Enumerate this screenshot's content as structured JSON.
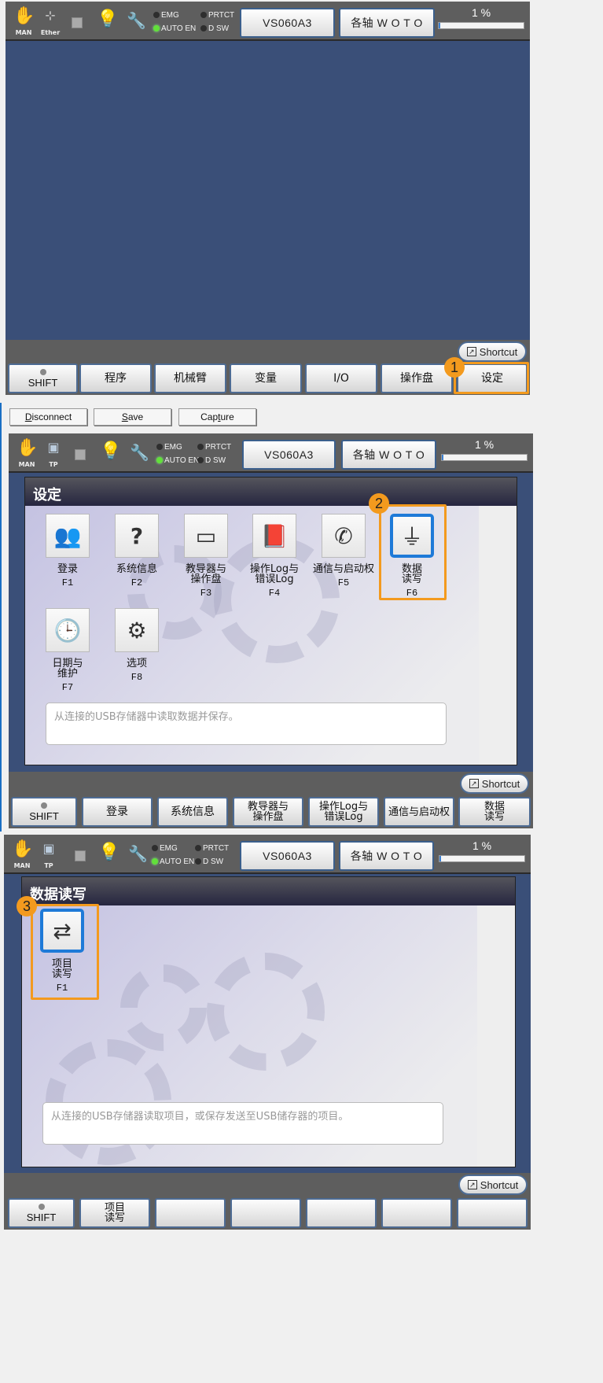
{
  "statusbar": {
    "mode_label": "MAN",
    "conn_label_1": "Ether",
    "conn_label_2": "TP",
    "indicators": {
      "emg": "EMG",
      "prtct": "PRTCT",
      "auto_en": "AUTO EN",
      "dsw": "D SW"
    },
    "robot_button": "VS060A3",
    "axis_button": "各轴 W O T O",
    "speed_text": "1 %",
    "speed_percent": 1
  },
  "screen1": {
    "shortcut": "Shortcut",
    "fkeys": [
      "SHIFT",
      "程序",
      "机械臂",
      "变量",
      "I/O",
      "操作盘",
      "设定"
    ],
    "step_badge": "1"
  },
  "controls": {
    "disconnect": {
      "hotkey": "D",
      "rest": "isconnect"
    },
    "save": {
      "hotkey": "S",
      "rest": "ave"
    },
    "capture": {
      "pre": "Cap",
      "hotkey": "t",
      "rest": "ure"
    }
  },
  "screen2": {
    "title": "设定",
    "step_badge": "2",
    "tiles": [
      {
        "label": "登录",
        "key": "F1",
        "icon": "user-login-icon"
      },
      {
        "label": "系统信息",
        "key": "F2",
        "icon": "robot-question-icon"
      },
      {
        "label": "教导器与\n操作盘",
        "key": "F3",
        "icon": "teach-pendant-icon"
      },
      {
        "label": "操作Log与\n错误Log",
        "key": "F4",
        "icon": "log-book-icon"
      },
      {
        "label": "通信与启动权",
        "key": "F5",
        "icon": "phone-icon"
      },
      {
        "label": "数据\n读写",
        "key": "F6",
        "icon": "usb-icon"
      },
      {
        "label": "日期与\n维护",
        "key": "F7",
        "icon": "calendar-clock-icon"
      },
      {
        "label": "选项",
        "key": "F8",
        "icon": "gears-icon"
      }
    ],
    "description": "从连接的USB存储器中读取数据并保存。",
    "shortcut": "Shortcut",
    "fkeys": [
      "SHIFT",
      "登录",
      "系统信息",
      "教导器与\n操作盘",
      "操作Log与\n错误Log",
      "通信与启动权",
      "数据\n读写"
    ]
  },
  "screen3": {
    "title": "数据读写",
    "step_badge": "3",
    "tiles": [
      {
        "label": "项目\n读写",
        "key": "F1",
        "icon": "usb-transfer-icon"
      }
    ],
    "description": "从连接的USB存储器读取项目，或保存发送至USB储存器的项目。",
    "shortcut": "Shortcut",
    "fkeys": [
      "SHIFT",
      "项目\n读写",
      "",
      "",
      "",
      "",
      ""
    ]
  },
  "colors": {
    "accent_highlight": "#f39a1e",
    "selected_border": "#1e7ad8",
    "content_bg": "#3a4f78",
    "chrome_bg": "#5e5e5e"
  }
}
